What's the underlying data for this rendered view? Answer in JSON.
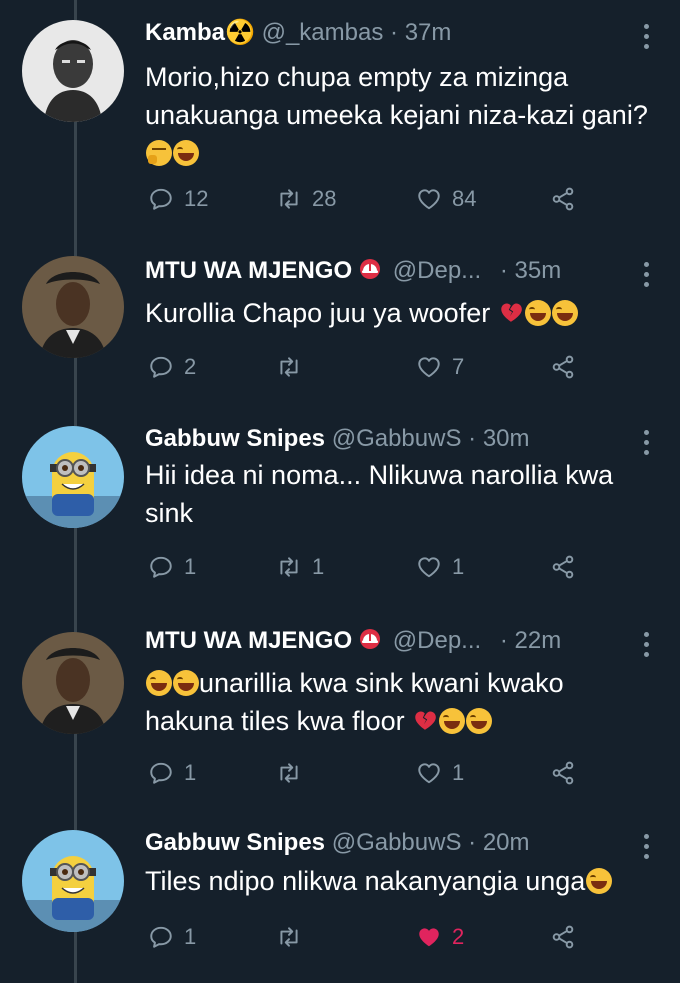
{
  "tweets": [
    {
      "display_name": "Kamba☢️",
      "handle": "@_kambas",
      "sep": "·",
      "time": "37m",
      "text": "Morio,hizo chupa empty za mizinga unakuanga umeeka kejani niza-kazi gani?",
      "emojis": [
        "thinking-face",
        "face-with-tears-of-joy"
      ],
      "replies": "12",
      "retweets": "28",
      "likes": "84",
      "liked": false
    },
    {
      "display_name": "MTU WA MJENGO",
      "handle": "@Dep...",
      "sep": "·",
      "time": "35m",
      "text": "Kurollia Chapo juu ya woofer",
      "emojis": [
        "broken-heart",
        "face-with-tears-of-joy",
        "face-with-tears-of-joy"
      ],
      "replies": "2",
      "retweets": "",
      "likes": "7",
      "liked": false
    },
    {
      "display_name": "Gabbuw Snipes",
      "handle": "@GabbuwS",
      "sep": "·",
      "time": "30m",
      "text": "Hii idea ni noma... Nlikuwa narollia kwa sink",
      "emojis": [],
      "replies": "1",
      "retweets": "1",
      "likes": "1",
      "liked": false
    },
    {
      "display_name": "MTU WA MJENGO",
      "handle": "@Dep...",
      "sep": "·",
      "time": "22m",
      "text_line1": "unarillia kwa sink kwani kwako",
      "text_line2": "hakuna tiles kwa floor",
      "emojis": [
        "face-with-tears-of-joy",
        "face-with-tears-of-joy",
        "broken-heart",
        "face-with-tears-of-joy",
        "face-with-tears-of-joy"
      ],
      "replies": "1",
      "retweets": "",
      "likes": "1",
      "liked": false
    },
    {
      "display_name": "Gabbuw Snipes",
      "handle": "@GabbuwS",
      "sep": "·",
      "time": "20m",
      "text": "Tiles ndipo nlikwa nakanyangia unga",
      "emojis": [
        "face-with-tears-of-joy"
      ],
      "replies": "1",
      "retweets": "",
      "likes": "2",
      "liked": true
    }
  ],
  "colors": {
    "background": "#15202b",
    "text": "#ffffff",
    "muted": "#8899a6",
    "like": "#e0245e",
    "thread_line": "#38444d"
  }
}
